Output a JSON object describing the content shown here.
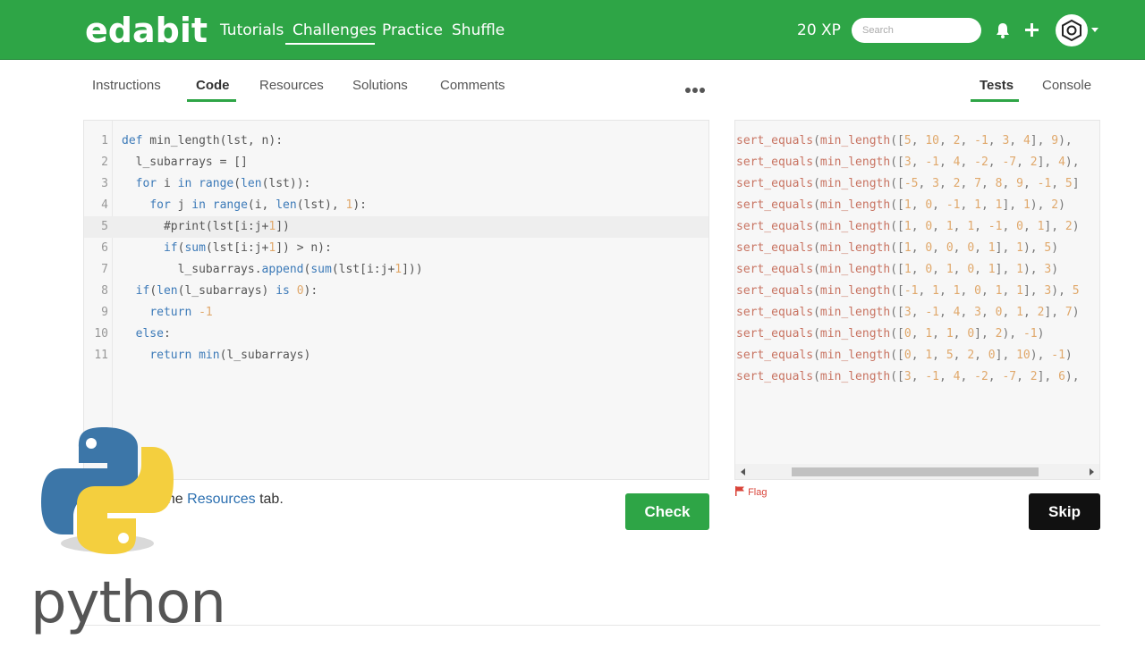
{
  "header": {
    "logo": "edabit",
    "nav": [
      "Tutorials",
      "Challenges",
      "Practice",
      "Shuffle"
    ],
    "active_nav": "Challenges",
    "xp": "20 XP",
    "search_placeholder": "Search",
    "brand_color": "#2ea546"
  },
  "tabs_left": [
    "Instructions",
    "Code",
    "Resources",
    "Solutions",
    "Comments"
  ],
  "active_left_tab": "Code",
  "tabs_right": [
    "Tests",
    "Console"
  ],
  "active_right_tab": "Tests",
  "code_lines": [
    {
      "n": "1",
      "text": "def min_length(lst, n):"
    },
    {
      "n": "2",
      "text": "  l_subarrays = []"
    },
    {
      "n": "3",
      "text": "  for i in range(len(lst)):"
    },
    {
      "n": "4",
      "text": "    for j in range(i, len(lst), 1):"
    },
    {
      "n": "5",
      "text": "      #print(lst[i:j+1])"
    },
    {
      "n": "6",
      "text": "      if(sum(lst[i:j+1]) > n):"
    },
    {
      "n": "7",
      "text": "        l_subarrays.append(sum(lst[i:j+1]))"
    },
    {
      "n": "8",
      "text": "  if(len(l_subarrays) is 0):"
    },
    {
      "n": "9",
      "text": "    return -1"
    },
    {
      "n": "10",
      "text": "  else:"
    },
    {
      "n": "11",
      "text": "    return min(l_subarrays)"
    }
  ],
  "test_lines": [
    "sert_equals(min_length([5, 10, 2, -1, 3, 4], 9),",
    "sert_equals(min_length([3, -1, 4, -2, -7, 2], 4),",
    "sert_equals(min_length([-5, 3, 2, 7, 8, 9, -1, 5]",
    "sert_equals(min_length([1, 0, -1, 1, 1], 1), 2)",
    "sert_equals(min_length([1, 0, 1, 1, -1, 0, 1], 2)",
    "sert_equals(min_length([1, 0, 0, 0, 1], 1), 5)",
    "sert_equals(min_length([1, 0, 1, 0, 1], 1), 3)",
    "sert_equals(min_length([-1, 1, 1, 0, 1, 1], 3), 5",
    "sert_equals(min_length([3, -1, 4, 3, 0, 1, 2], 7)",
    "sert_equals(min_length([0, 1, 1, 0], 2), -1)",
    "sert_equals(min_length([0, 1, 5, 2, 0], 10), -1)",
    "sert_equals(min_length([3, -1, 4, -2, -7, 2], 6),"
  ],
  "hint": {
    "prefix": "k the ",
    "link": "Resources",
    "suffix": " tab."
  },
  "buttons": {
    "check": "Check",
    "skip": "Skip",
    "flag": "Flag"
  },
  "overlay": {
    "python_word": "python"
  }
}
